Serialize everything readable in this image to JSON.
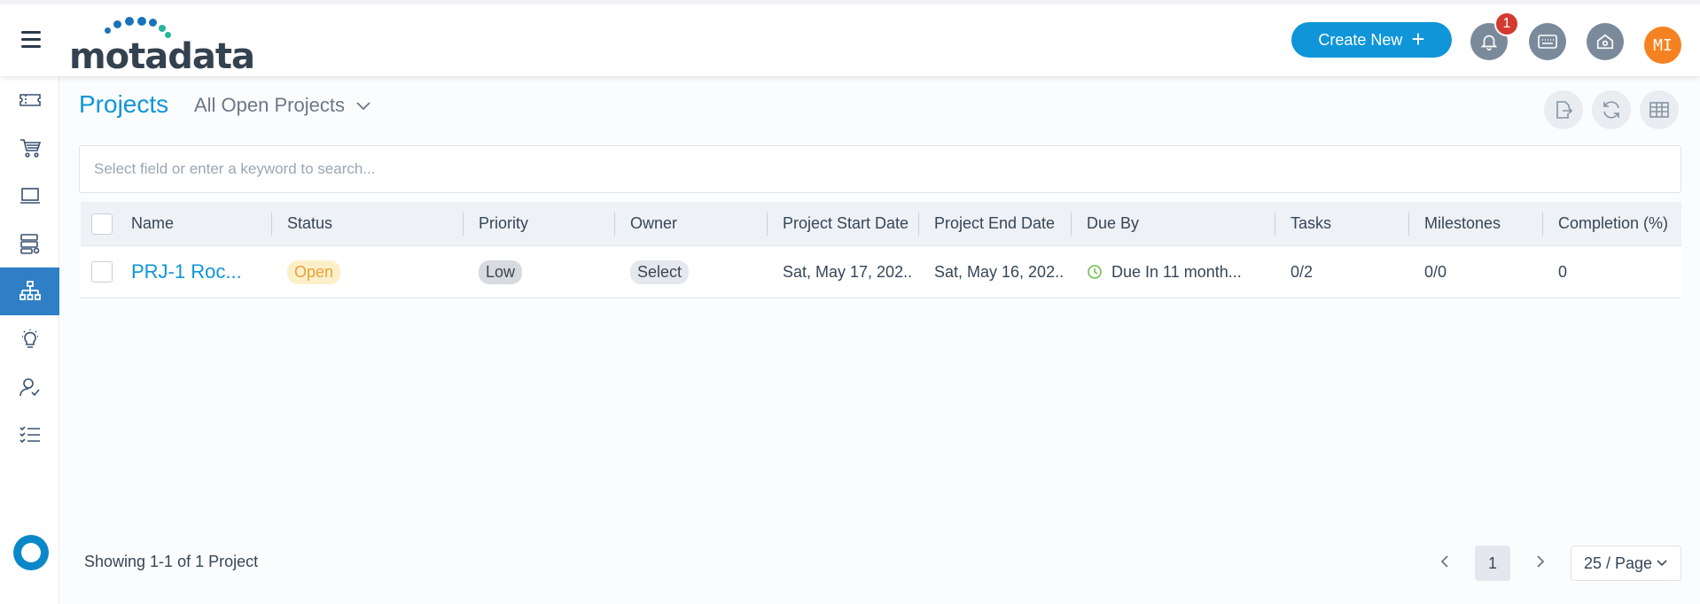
{
  "header": {
    "logo_text": "motadata",
    "create_label": "Create New",
    "notification_count": "1",
    "avatar_initials": "MI"
  },
  "sidebar": {
    "items": [
      {
        "name": "tickets",
        "icon": "ticket-icon"
      },
      {
        "name": "service-catalog",
        "icon": "cart-icon"
      },
      {
        "name": "assets",
        "icon": "laptop-icon"
      },
      {
        "name": "cmdb",
        "icon": "database-icon"
      },
      {
        "name": "projects",
        "icon": "hierarchy-icon",
        "active": true
      },
      {
        "name": "knowledge",
        "icon": "lightbulb-icon"
      },
      {
        "name": "users",
        "icon": "user-check-icon"
      },
      {
        "name": "tasks",
        "icon": "checklist-icon"
      }
    ]
  },
  "page": {
    "title": "Projects",
    "view_label": "All Open Projects",
    "search_placeholder": "Select field or enter a keyword to search..."
  },
  "table": {
    "columns": [
      "Name",
      "Status",
      "Priority",
      "Owner",
      "Project Start Date",
      "Project End Date",
      "Due By",
      "Tasks",
      "Milestones",
      "Completion (%)"
    ],
    "rows": [
      {
        "name": "PRJ-1 Roc...",
        "status": "Open",
        "priority": "Low",
        "owner": "Select",
        "start_date": "Sat, May 17, 202...",
        "end_date": "Sat, May 16, 202...",
        "due_by": "Due In 11 month...",
        "tasks": "0/2",
        "milestones": "0/0",
        "completion": "0"
      }
    ]
  },
  "footer": {
    "showing": "Showing 1-1 of 1 Project",
    "current_page": "1",
    "page_size": "25 / Page"
  },
  "colors": {
    "accent": "#0f95d8",
    "sidebar_active": "#2f7fc6",
    "badge": "#d33a30",
    "avatar": "#f58220"
  }
}
